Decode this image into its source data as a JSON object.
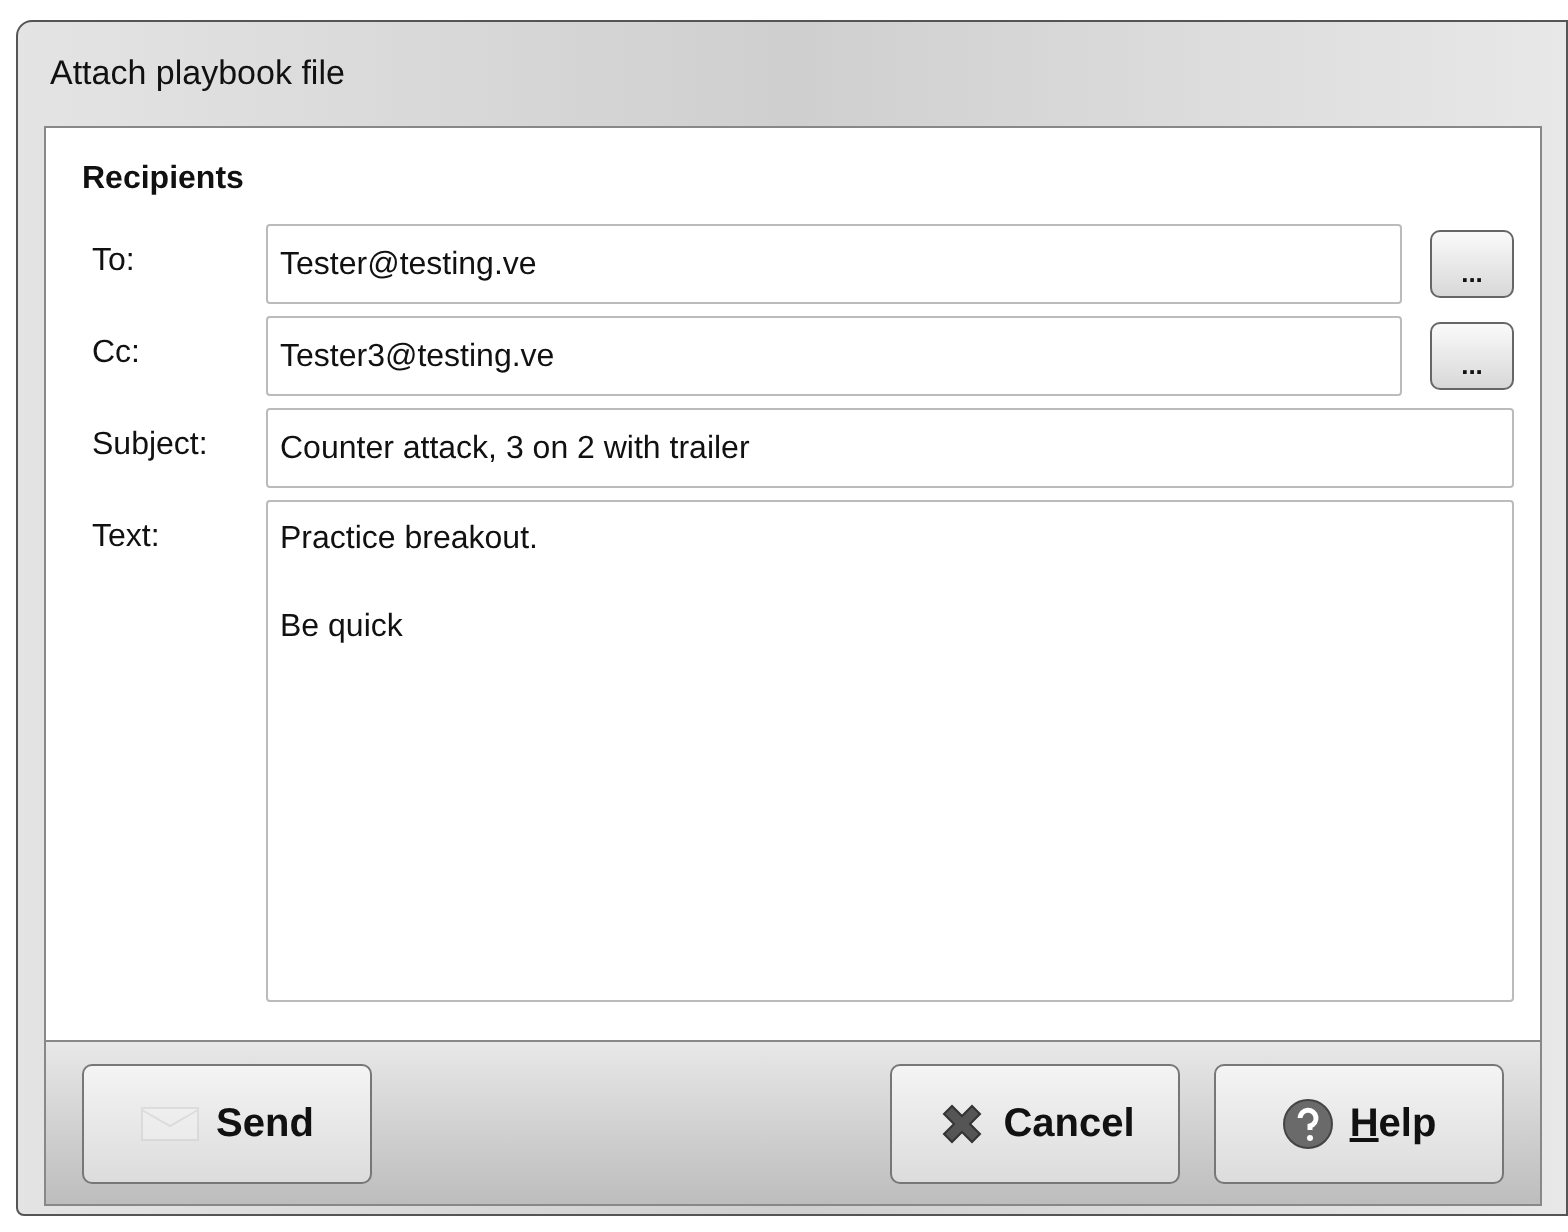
{
  "window": {
    "title": "Attach playbook file"
  },
  "section": {
    "title": "Recipients"
  },
  "fields": [
    {
      "label": "To:",
      "value": "Tester@testing.ve",
      "kind": "address",
      "browse": "..."
    },
    {
      "label": "Cc:",
      "value": "Tester3@testing.ve",
      "kind": "address",
      "browse": "..."
    },
    {
      "label": "Subject:",
      "value": "Counter attack, 3 on 2 with trailer",
      "kind": "line"
    },
    {
      "label": "Text:",
      "value": "Practice breakout.\n\nBe quick",
      "kind": "multiline"
    }
  ],
  "buttons": [
    {
      "label": "Send",
      "kind": "send",
      "disabled_icon": true
    },
    {
      "label": "Cancel",
      "kind": "cancel",
      "disabled_icon": false
    },
    {
      "label": "Help",
      "kind": "help",
      "disabled_icon": false,
      "underline_first": true
    }
  ]
}
